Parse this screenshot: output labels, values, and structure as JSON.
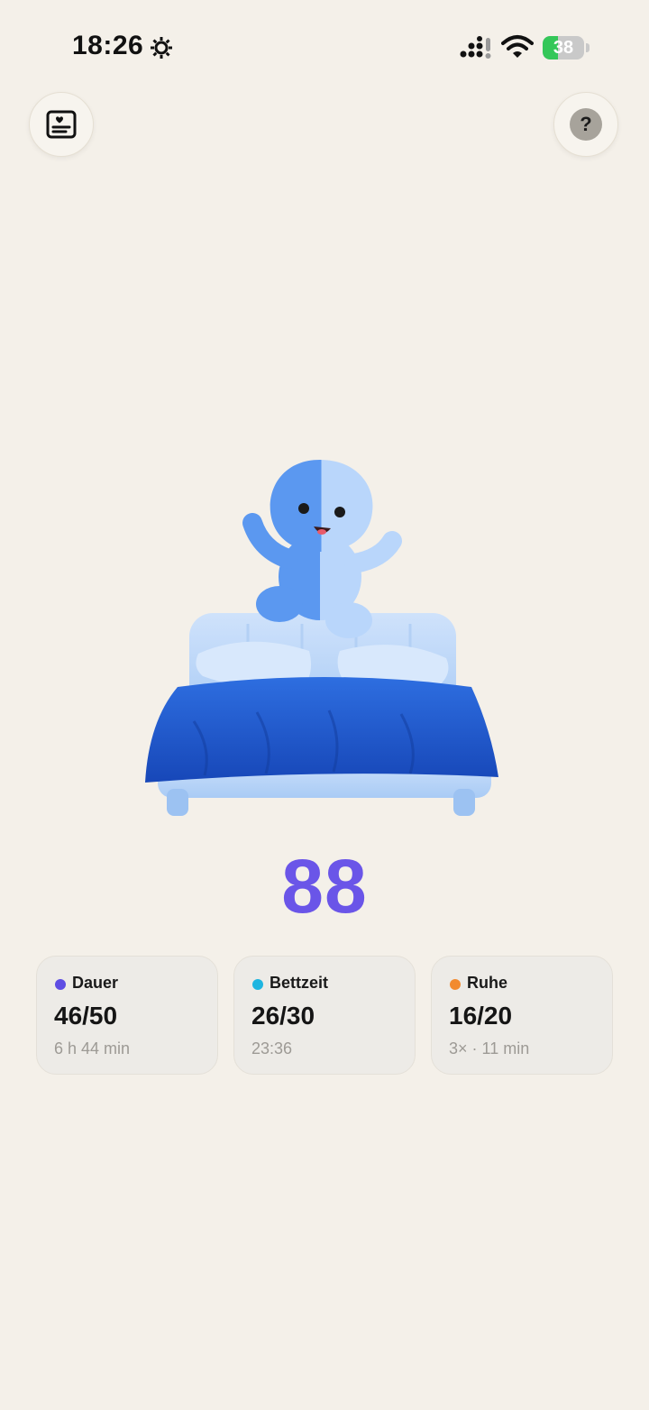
{
  "status_bar": {
    "time": "18:26",
    "battery_level": "38",
    "battery_fraction": 0.38,
    "battery_color": "#34c759"
  },
  "header": {
    "left_icon": "journal-heart-icon",
    "right_icon": "help-icon",
    "help_glyph": "?"
  },
  "illustration": {
    "subject": "bed-mascot-icon"
  },
  "score": {
    "value": "88",
    "color": "#6a55e8"
  },
  "metrics": [
    {
      "label": "Dauer",
      "value": "46/50",
      "detail": "6 h 44 min",
      "color": "#5e4de3"
    },
    {
      "label": "Bettzeit",
      "value": "26/30",
      "detail": "23:36",
      "color": "#1fb5e0"
    },
    {
      "label": "Ruhe",
      "value": "16/20",
      "detail": "3× · 11 min",
      "color": "#f28a2e"
    }
  ]
}
